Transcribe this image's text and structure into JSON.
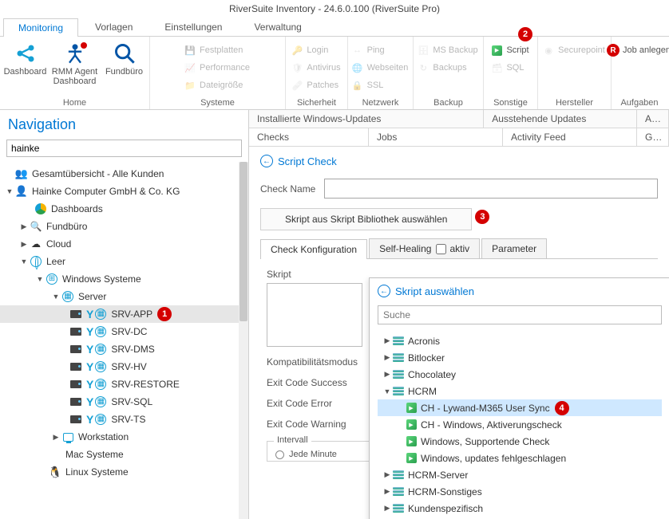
{
  "title": "RiverSuite Inventory - 24.6.0.100 (RiverSuite Pro)",
  "main_tabs": [
    "Monitoring",
    "Vorlagen",
    "Einstellungen",
    "Verwaltung"
  ],
  "ribbon": {
    "home": {
      "label": "Home",
      "dashboard": "Dashboard",
      "rmm": "RMM Agent Dashboard",
      "fundburo": "Fundbüro"
    },
    "systeme": {
      "label": "Systeme",
      "festplatten": "Festplatten",
      "performance": "Performance",
      "dateigrosse": "Dateigröße"
    },
    "sicherheit": {
      "label": "Sicherheit",
      "login": "Login",
      "antivirus": "Antivirus",
      "patches": "Patches"
    },
    "netzwerk": {
      "label": "Netzwerk",
      "ping": "Ping",
      "webseiten": "Webseiten",
      "ssl": "SSL"
    },
    "backup": {
      "label": "Backup",
      "ms": "MS Backup",
      "backups": "Backups"
    },
    "sonstige": {
      "label": "Sonstige",
      "script": "Script",
      "sql": "SQL"
    },
    "hersteller": {
      "label": "Hersteller",
      "securepoint": "Securepoint"
    },
    "aufgaben": {
      "label": "Aufgaben",
      "job": "Job anlegen"
    }
  },
  "nav": {
    "title": "Navigation",
    "search_value": "hainke",
    "items": {
      "all": "Gesamtübersicht - Alle Kunden",
      "company": "Hainke Computer GmbH & Co. KG",
      "dashboards": "Dashboards",
      "fundburo": "Fundbüro",
      "cloud": "Cloud",
      "leer": "Leer",
      "winsys": "Windows Systeme",
      "server": "Server",
      "servers": [
        "SRV-APP",
        "SRV-DC",
        "SRV-DMS",
        "SRV-HV",
        "SRV-RESTORE",
        "SRV-SQL",
        "SRV-TS"
      ],
      "workstation": "Workstation",
      "mac": "Mac Systeme",
      "linux": "Linux Systeme"
    }
  },
  "content_tabs_row1": [
    "Installierte Windows-Updates",
    "Ausstehende Updates",
    "Antivirus"
  ],
  "content_tabs_row2": [
    "Checks",
    "Jobs",
    "Activity Feed",
    "Geräte"
  ],
  "check": {
    "back": "Script Check",
    "name_label": "Check Name",
    "lib_button": "Skript aus Skript Bibliothek auswählen",
    "tabs": {
      "cfg": "Check Konfiguration",
      "self": "Self-Healing",
      "aktiv": "aktiv",
      "param": "Parameter"
    },
    "script_label": "Skript",
    "compat": "Kompatibilitätsmodus",
    "exit_success": "Exit Code Success",
    "exit_error": "Exit Code Error",
    "exit_warning": "Exit Code Warning",
    "interval": "Intervall",
    "every_min": "Jede Minute"
  },
  "picker": {
    "title": "Skript auswählen",
    "search_placeholder": "Suche",
    "groups": {
      "acronis": "Acronis",
      "bitlocker": "Bitlocker",
      "choco": "Chocolatey",
      "hcrm": "HCRM",
      "hcrm_items": [
        "CH - Lywand-M365 User Sync",
        "CH - Windows, Aktiverungscheck",
        "Windows, Supportende Check",
        "Windows, updates fehlgeschlagen"
      ],
      "hcrm_server": "HCRM-Server",
      "hcrm_sonst": "HCRM-Sonstiges",
      "kunden": "Kundenspezifisch"
    }
  },
  "badges": {
    "b1": "1",
    "b2": "2",
    "b3": "3",
    "b4": "4"
  }
}
